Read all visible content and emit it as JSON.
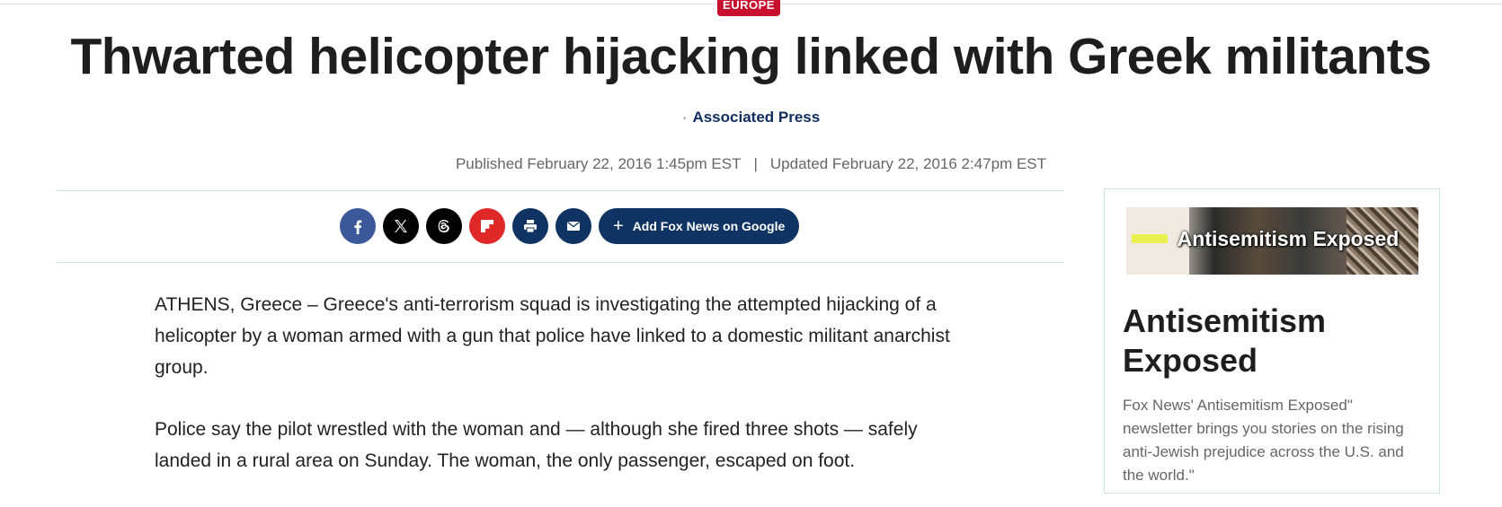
{
  "category": "EUROPE",
  "headline": "Thwarted helicopter hijacking linked with Greek militants",
  "byline": {
    "dot": "·",
    "author": "Associated Press"
  },
  "dates": {
    "published": "Published February 22, 2016 1:45pm EST",
    "separator": "|",
    "updated": "Updated February 22, 2016 2:47pm EST"
  },
  "share": {
    "icons": [
      "facebook-icon",
      "x-icon",
      "threads-icon",
      "flipboard-icon",
      "print-icon",
      "email-icon"
    ],
    "google_button": "Add Fox News on Google"
  },
  "article": {
    "paragraphs": [
      "ATHENS, Greece – Greece's anti-terrorism squad is investigating the attempted hijacking of a helicopter by a woman armed with a gun that police have linked to a domestic militant anarchist group.",
      "Police say the pilot wrestled with the woman and — although she fired three shots — safely landed in a rural area on Sunday. The woman, the only passenger, escaped on foot."
    ]
  },
  "sidebar": {
    "promo_image_text": "Antisemitism Exposed",
    "title": "Antisemitism Exposed",
    "description": "Fox News' Antisemitism Exposed\" newsletter brings you stories on the rising anti-Jewish prejudice across the U.S. and the world.\""
  },
  "colors": {
    "brand_navy": "#0f3463",
    "category_red": "#c8102e",
    "facebook": "#3b5998",
    "flipboard": "#e12828"
  }
}
